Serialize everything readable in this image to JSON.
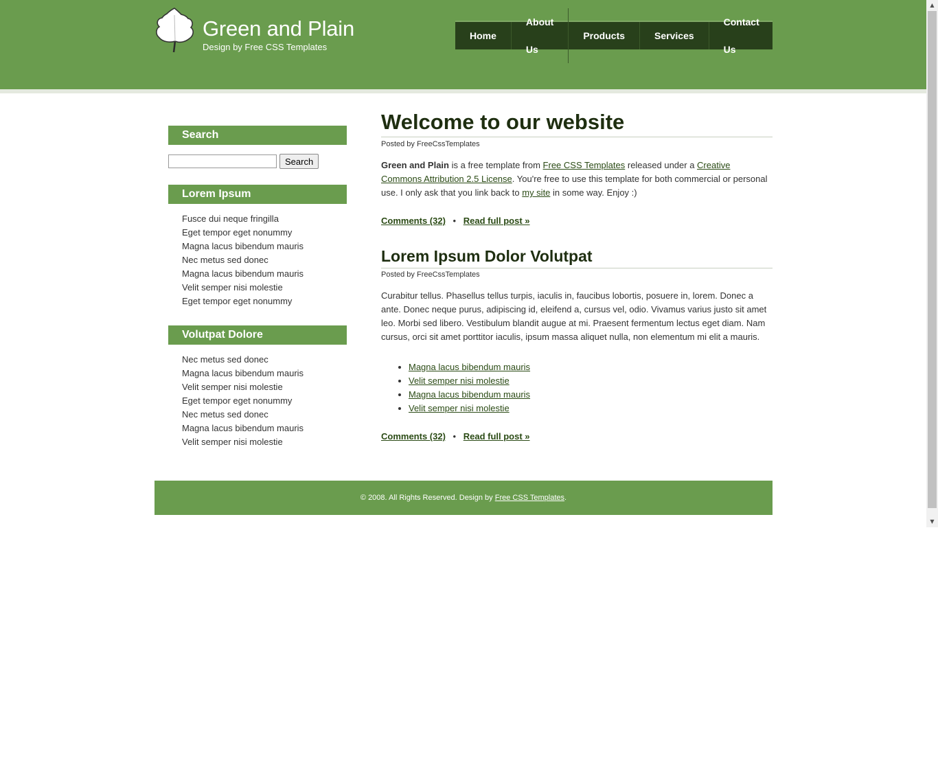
{
  "header": {
    "title": "Green and Plain",
    "subtitle": "Design by Free CSS Templates",
    "logo_icon": "leaf-icon"
  },
  "menu": {
    "items": [
      {
        "label": "Home"
      },
      {
        "label": "About Us"
      },
      {
        "label": "Products"
      },
      {
        "label": "Services"
      },
      {
        "label": "Contact Us"
      }
    ]
  },
  "sidebar": {
    "search": {
      "heading": "Search",
      "input_value": "",
      "button_label": "Search"
    },
    "lorem": {
      "heading": "Lorem Ipsum",
      "items": [
        "Fusce dui neque fringilla",
        "Eget tempor eget nonummy",
        "Magna lacus bibendum mauris",
        "Nec metus sed donec",
        "Magna lacus bibendum mauris",
        "Velit semper nisi molestie",
        "Eget tempor eget nonummy"
      ]
    },
    "volutpat": {
      "heading": "Volutpat Dolore",
      "items": [
        "Nec metus sed donec",
        "Magna lacus bibendum mauris",
        "Velit semper nisi molestie",
        "Eget tempor eget nonummy",
        "Nec metus sed donec",
        "Magna lacus bibendum mauris",
        "Velit semper nisi molestie"
      ]
    }
  },
  "posts": [
    {
      "title": "Welcome to our website",
      "byline": "Posted by FreeCssTemplates",
      "intro_bold": "Green and Plain",
      "text_1": " is a free template from ",
      "link_1": "Free CSS Templates",
      "text_2": " released under a ",
      "link_2": "Creative Commons Attribution 2.5 License",
      "text_3": ". You're free to use this template for both commercial or personal use. I only ask that you link back to ",
      "link_3": "my site",
      "text_4": " in some way. Enjoy :)",
      "comments": "Comments (32)",
      "separator": "•",
      "read_more": "Read full post »"
    },
    {
      "title": "Lorem Ipsum Dolor Volutpat",
      "byline": "Posted by FreeCssTemplates",
      "body": "Curabitur tellus. Phasellus tellus turpis, iaculis in, faucibus lobortis, posuere in, lorem. Donec a ante. Donec neque purus, adipiscing id, eleifend a, cursus vel, odio. Vivamus varius justo sit amet leo. Morbi sed libero. Vestibulum blandit augue at mi. Praesent fermentum lectus eget diam. Nam cursus, orci sit amet porttitor iaculis, ipsum massa aliquet nulla, non elementum mi elit a mauris.",
      "links": [
        "Magna lacus bibendum mauris",
        "Velit semper nisi molestie",
        "Magna lacus bibendum mauris",
        "Velit semper nisi molestie"
      ],
      "comments": "Comments (32)",
      "separator": "•",
      "read_more": "Read full post »"
    }
  ],
  "footer": {
    "text": "© 2008. All Rights Reserved. Design by ",
    "link": "Free CSS Templates",
    "end": "."
  },
  "scrollbar": {
    "up_icon": "arrow-up-icon",
    "down_icon": "arrow-down-icon"
  },
  "colors": {
    "header_green": "#6a9c4e",
    "menu_dark": "#28401b",
    "title_dark": "#1e2e10",
    "link_green": "#2a4a14"
  }
}
